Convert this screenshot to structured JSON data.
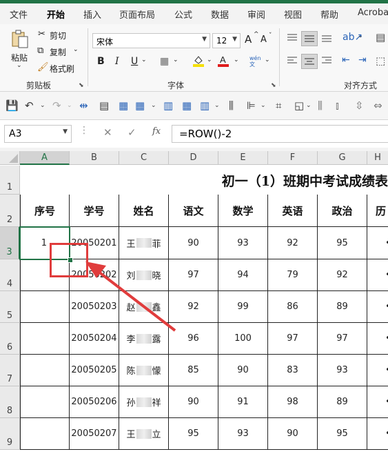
{
  "menu": [
    "文件",
    "开始",
    "插入",
    "页面布局",
    "公式",
    "数据",
    "审阅",
    "视图",
    "帮助",
    "Acroba"
  ],
  "clipboard": {
    "paste": "粘贴",
    "cut": "剪切",
    "copy": "复制",
    "format_painter": "格式刷",
    "group": "剪贴板"
  },
  "font": {
    "name": "宋体",
    "size": "12",
    "group": "字体",
    "bold": "B",
    "italic": "I",
    "underline": "U",
    "grow": "A",
    "shrink": "A",
    "wen": "wén 文"
  },
  "alignment": {
    "group": "对齐方式"
  },
  "name_box": "A3",
  "formula": "=ROW()-2",
  "fx": "fx",
  "columns": [
    "A",
    "B",
    "C",
    "D",
    "E",
    "F",
    "G",
    "H"
  ],
  "row_numbers": [
    "1",
    "2",
    "3",
    "4",
    "5",
    "6",
    "7",
    "8",
    "9"
  ],
  "sheet": {
    "title": "初一（1）班期中考试成绩表",
    "headers": [
      "序号",
      "学号",
      "姓名",
      "语文",
      "数学",
      "英语",
      "政治",
      "历"
    ],
    "rows": [
      {
        "seq": "1",
        "id": "20050201",
        "name_first": "王",
        "name_last": "菲",
        "scores": [
          "90",
          "93",
          "92",
          "95"
        ]
      },
      {
        "seq": "",
        "id": "20050202",
        "name_first": "刘",
        "name_last": "晓",
        "scores": [
          "97",
          "94",
          "79",
          "92"
        ]
      },
      {
        "seq": "",
        "id": "20050203",
        "name_first": "赵",
        "name_last": "鑫",
        "scores": [
          "92",
          "99",
          "86",
          "89"
        ]
      },
      {
        "seq": "",
        "id": "20050204",
        "name_first": "李",
        "name_last": "露",
        "scores": [
          "96",
          "100",
          "97",
          "97"
        ]
      },
      {
        "seq": "",
        "id": "20050205",
        "name_first": "陈",
        "name_last": "懞",
        "scores": [
          "85",
          "90",
          "83",
          "93"
        ]
      },
      {
        "seq": "",
        "id": "20050206",
        "name_first": "孙",
        "name_last": "祥",
        "scores": [
          "90",
          "91",
          "98",
          "89"
        ]
      },
      {
        "seq": "",
        "id": "20050207",
        "name_first": "王",
        "name_last": "立",
        "scores": [
          "95",
          "93",
          "90",
          "95"
        ]
      }
    ]
  },
  "colors": {
    "accent": "#217346",
    "annotation": "#e03c3c"
  }
}
